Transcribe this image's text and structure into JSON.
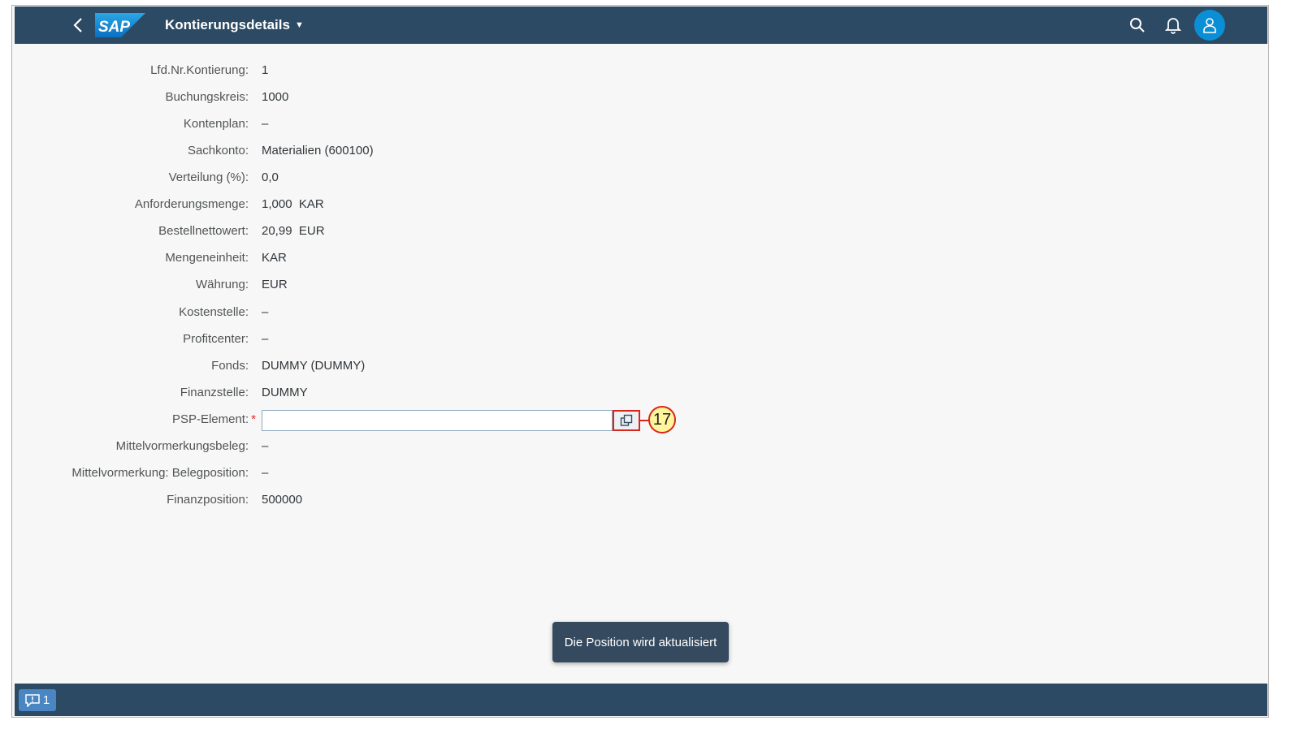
{
  "shell": {
    "title": "Kontierungsdetails",
    "logo_text": "SAP",
    "icons": [
      "back-icon",
      "search-icon",
      "bell-icon",
      "user-icon"
    ]
  },
  "fields": [
    {
      "label": "Lfd.Nr.Kontierung:",
      "value": "1"
    },
    {
      "label": "Buchungskreis:",
      "value": "1000"
    },
    {
      "label": "Kontenplan:",
      "value": "–"
    },
    {
      "label": "Sachkonto:",
      "value": "Materialien (600100)"
    },
    {
      "label": "Verteilung (%):",
      "value": "0,0"
    },
    {
      "label": "Anforderungsmenge:",
      "value": "1,000  KAR"
    },
    {
      "label": "Bestellnettowert:",
      "value": "20,99  EUR"
    },
    {
      "label": "Mengeneinheit:",
      "value": "KAR"
    },
    {
      "label": "Währung:",
      "value": "EUR"
    },
    {
      "label": "Kostenstelle:",
      "value": "–"
    },
    {
      "label": "Profitcenter:",
      "value": "–"
    },
    {
      "label": "Fonds:",
      "value": "DUMMY (DUMMY)"
    },
    {
      "label": "Finanzstelle:",
      "value": "DUMMY"
    }
  ],
  "psp": {
    "label": "PSP-Element:",
    "required_mark": "*",
    "value": "",
    "callout": "17"
  },
  "fields_after": [
    {
      "label": "Mittelvormerkungsbeleg:",
      "value": "–"
    },
    {
      "label": "Mittelvormerkung: Belegposition:",
      "value": "–"
    },
    {
      "label": "Finanzposition:",
      "value": "500000"
    }
  ],
  "toast": {
    "text": "Die Position wird aktualisiert"
  },
  "footer": {
    "message_count": "1"
  },
  "colors": {
    "shell": "#2c4a63",
    "accent": "#0a8fd6",
    "toast": "#354a5f",
    "required": "#e22c2c"
  }
}
